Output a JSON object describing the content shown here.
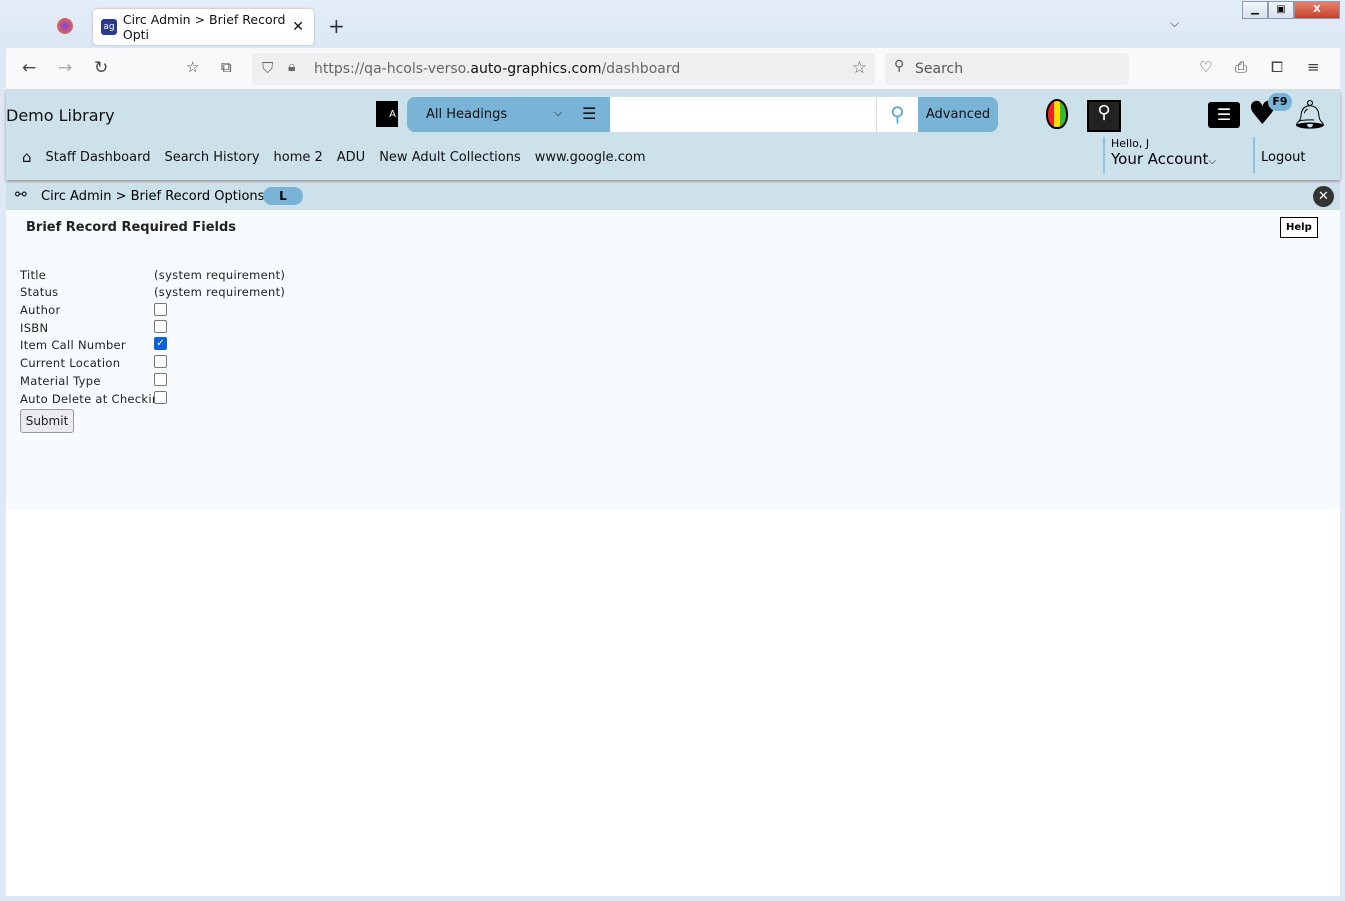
{
  "browser": {
    "tab_title": "Circ Admin > Brief Record Opti",
    "url_prefix": "https://qa-hcols-verso.",
    "url_domain": "auto-graphics.com",
    "url_path": "/dashboard",
    "search_placeholder": "Search"
  },
  "header": {
    "library": "Demo Library",
    "search_type": "All Headings",
    "advanced": "Advanced",
    "badge": "F9",
    "hello": "Hello, J",
    "account": "Your Account",
    "logout": "Logout",
    "menu": [
      "Staff Dashboard",
      "Search History",
      "home 2",
      "ADU",
      "New Adult Collections",
      "www.google.com"
    ]
  },
  "breadcrumb": {
    "text": "Circ Admin > Brief Record Options",
    "pill": "L"
  },
  "form": {
    "title": "Brief Record Required Fields",
    "help": "Help",
    "submit": "Submit",
    "fields": [
      {
        "label": "Title",
        "value": "(system requirement)"
      },
      {
        "label": "Status",
        "value": "(system requirement)"
      },
      {
        "label": "Author",
        "checked": false
      },
      {
        "label": "ISBN",
        "checked": false
      },
      {
        "label": "Item Call Number",
        "checked": true
      },
      {
        "label": "Current Location",
        "checked": false
      },
      {
        "label": "Material Type",
        "checked": false
      },
      {
        "label": "Auto Delete at Checkin",
        "checked": false
      }
    ]
  }
}
